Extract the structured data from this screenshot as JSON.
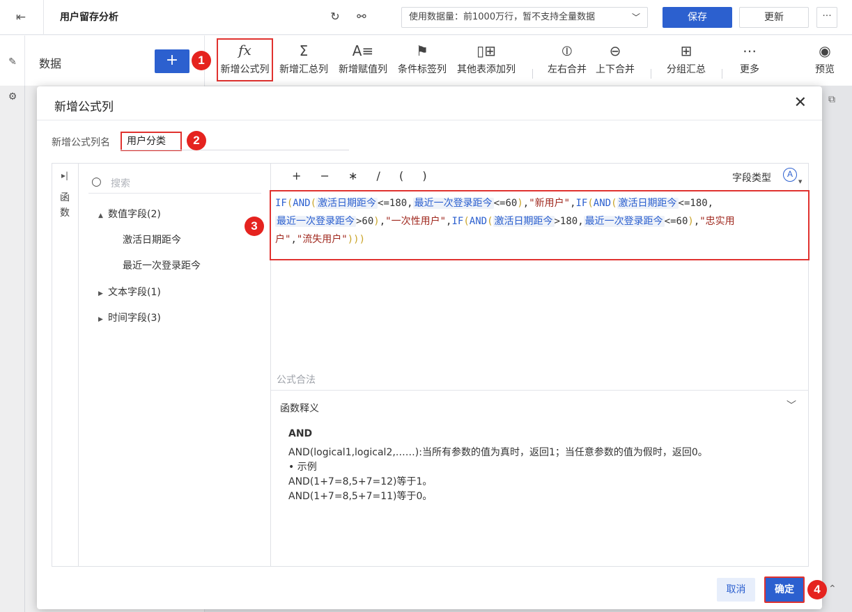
{
  "topbar": {
    "title": "用户留存分析",
    "data_scope": "使用数据量：前1000万行，暂不支持全量数据",
    "save_label": "保存",
    "update_label": "更新",
    "more_label": "···",
    "icons": [
      "exit-icon",
      "refresh-icon",
      "flow-icon"
    ]
  },
  "data_panel": {
    "title": "数据",
    "add_label": "+"
  },
  "toolbar": {
    "items": [
      {
        "label": "新增公式列",
        "icon": "formula-icon",
        "glyph": "fx"
      },
      {
        "label": "新增汇总列",
        "icon": "sum-icon",
        "glyph": "Σ"
      },
      {
        "label": "新增赋值列",
        "icon": "assign-icon",
        "glyph": "A≡"
      },
      {
        "label": "条件标签列",
        "icon": "flag-icon",
        "glyph": "⚑"
      },
      {
        "label": "其他表添加列",
        "icon": "add-column-icon",
        "glyph": "▯+"
      },
      {
        "label": "左右合并",
        "icon": "merge-lr-icon",
        "glyph": "⦶"
      },
      {
        "label": "上下合并",
        "icon": "merge-tb-icon",
        "glyph": "⊖"
      },
      {
        "label": "分组汇总",
        "icon": "group-icon",
        "glyph": "⊞"
      },
      {
        "label": "更多",
        "icon": "more-icon",
        "glyph": "⋯"
      },
      {
        "label": "预览",
        "icon": "preview-icon",
        "glyph": "◉"
      }
    ]
  },
  "badges": [
    "1",
    "2",
    "3",
    "4"
  ],
  "dialog": {
    "title": "新增公式列",
    "close": "✕",
    "name_label": "新增公式列名",
    "name_value": "用户分类",
    "fn_tab_label": "函数",
    "search_placeholder": "搜索",
    "tree": [
      {
        "label": "数值字段(2)",
        "expanded": true,
        "children": [
          "激活日期距今",
          "最近一次登录距今"
        ]
      },
      {
        "label": "文本字段(1)",
        "expanded": false
      },
      {
        "label": "时间字段(3)",
        "expanded": false
      }
    ],
    "operators": [
      "+",
      "−",
      "∗",
      "/",
      "(",
      ")"
    ],
    "field_type_label": "字段类型",
    "field_type_icon": "Ⓐ",
    "formula": [
      {
        "t": "fn",
        "v": "IF"
      },
      {
        "t": "paren",
        "v": "("
      },
      {
        "t": "fn",
        "v": "AND"
      },
      {
        "t": "paren",
        "v": "("
      },
      {
        "t": "field",
        "v": "激活日期距今"
      },
      {
        "t": "txt",
        "v": "<=180,"
      },
      {
        "t": "field",
        "v": "最近一次登录距今"
      },
      {
        "t": "txt",
        "v": "<=60"
      },
      {
        "t": "paren",
        "v": ")"
      },
      {
        "t": "txt",
        "v": ","
      },
      {
        "t": "str",
        "v": "\"新用户\""
      },
      {
        "t": "txt",
        "v": ","
      },
      {
        "t": "fn",
        "v": "IF"
      },
      {
        "t": "paren",
        "v": "("
      },
      {
        "t": "fn",
        "v": "AND"
      },
      {
        "t": "paren",
        "v": "("
      },
      {
        "t": "field",
        "v": "激活日期距今"
      },
      {
        "t": "txt",
        "v": "<=180,"
      },
      {
        "t": "br",
        "v": ""
      },
      {
        "t": "field",
        "v": "最近一次登录距今"
      },
      {
        "t": "txt",
        "v": ">60"
      },
      {
        "t": "paren",
        "v": ")"
      },
      {
        "t": "txt",
        "v": ","
      },
      {
        "t": "str",
        "v": "\"一次性用户\""
      },
      {
        "t": "txt",
        "v": ","
      },
      {
        "t": "fn",
        "v": "IF"
      },
      {
        "t": "paren",
        "v": "("
      },
      {
        "t": "fn",
        "v": "AND"
      },
      {
        "t": "paren",
        "v": "("
      },
      {
        "t": "field",
        "v": "激活日期距今"
      },
      {
        "t": "txt",
        "v": ">180,"
      },
      {
        "t": "field",
        "v": "最近一次登录距今"
      },
      {
        "t": "txt",
        "v": "<=60"
      },
      {
        "t": "paren",
        "v": ")"
      },
      {
        "t": "txt",
        "v": ","
      },
      {
        "t": "str",
        "v": "\"忠实用"
      },
      {
        "t": "br",
        "v": ""
      },
      {
        "t": "str",
        "v": "户\""
      },
      {
        "t": "txt",
        "v": ","
      },
      {
        "t": "str",
        "v": "\"流失用户\""
      },
      {
        "t": "paren",
        "v": ")))"
      }
    ],
    "validity_text": "公式合法",
    "help_title": "函数释义",
    "help": {
      "fn_name": "AND",
      "lines": [
        "AND(logical1,logical2,……):当所有参数的值为真时，返回1；当任意参数的值为假时，返回0。",
        "• 示例",
        "AND(1+7=8,5+7=12)等于1。",
        "AND(1+7=8,5+7=11)等于0。"
      ]
    },
    "cancel_label": "取消",
    "ok_label": "确定"
  },
  "colors": {
    "primary": "#2c60cf",
    "highlight_border": "#e0322f",
    "badge": "#e5231f"
  }
}
